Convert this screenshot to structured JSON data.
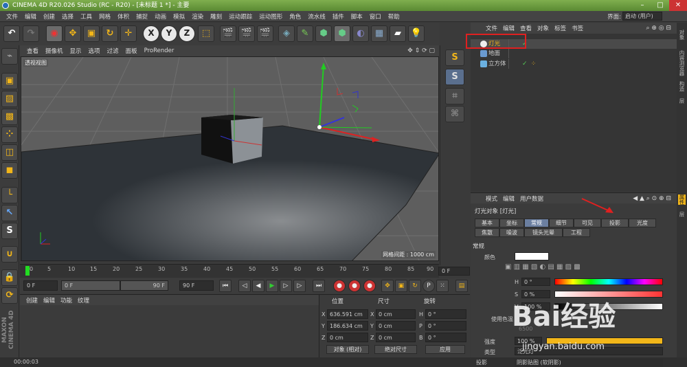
{
  "window": {
    "title": "CINEMA 4D R20.026 Studio (RC - R20) - [未标题 1 *] - 主要"
  },
  "menu": [
    "文件",
    "编辑",
    "创建",
    "选择",
    "工具",
    "网格",
    "体积",
    "捕捉",
    "动画",
    "模拟",
    "渲染",
    "雕刻",
    "运动跟踪",
    "运动图形",
    "角色",
    "流水线",
    "插件",
    "脚本",
    "窗口",
    "帮助"
  ],
  "layout": {
    "label": "界面:",
    "value": "启动 (用户)"
  },
  "toolbar": {
    "x_label": "X",
    "y_label": "Y",
    "z_label": "Z"
  },
  "viewport": {
    "menu": [
      "查看",
      "摄像机",
      "显示",
      "选项",
      "过滤",
      "面板",
      "ProRender"
    ],
    "label": "透视视图",
    "grid_label": "网格间距 : 1000 cm"
  },
  "timeline": {
    "ticks": [
      "0",
      "5",
      "10",
      "15",
      "20",
      "25",
      "30",
      "35",
      "40",
      "45",
      "50",
      "55",
      "60",
      "65",
      "70",
      "75",
      "80",
      "85",
      "90"
    ],
    "frame_value": "0 F",
    "start": "0 F",
    "min": "0 F",
    "max": "90 F",
    "end": "90 F"
  },
  "material_panel": {
    "tabs": [
      "创建",
      "编辑",
      "功能",
      "纹理"
    ]
  },
  "coords": {
    "headers": [
      "位置",
      "尺寸",
      "旋转"
    ],
    "pos": {
      "x": "636.591 cm",
      "y": "186.634 cm",
      "z": "0 cm"
    },
    "size": {
      "x": "0 cm",
      "y": "0 cm",
      "z": "0 cm"
    },
    "rot": {
      "h": "0 °",
      "p": "0 °",
      "b": "0 °"
    },
    "axis_labels": {
      "x": "X",
      "y": "Y",
      "z": "Z",
      "h": "H",
      "p": "P",
      "b": "B"
    },
    "mode": "对象 (相对)",
    "size_mode": "绝对尺寸",
    "apply": "应用"
  },
  "status": {
    "time": "00:00:03"
  },
  "brand": "MAXON CINEMA 4D",
  "object_manager": {
    "menu": [
      "文件",
      "编辑",
      "查看",
      "对象",
      "标签",
      "书签"
    ],
    "objects": [
      {
        "name": "灯光",
        "selected": true
      },
      {
        "name": "地面",
        "selected": false
      },
      {
        "name": "立方体",
        "selected": false
      }
    ]
  },
  "attribute_manager": {
    "menu": [
      "模式",
      "编辑",
      "用户数据"
    ],
    "title": "灯光对象 [灯光]",
    "tabs_row1": [
      "基本",
      "坐标",
      "常规",
      "细节",
      "可见",
      "投影",
      "光度"
    ],
    "tabs_row2": [
      "焦散",
      "噪波",
      "镜头光晕",
      "工程"
    ],
    "active_tab": "常规",
    "section": "常规",
    "color_label": "颜色",
    "h_label": "H",
    "h_value": "0 °",
    "s_label": "S",
    "s_value": "0 %",
    "v_label": "V",
    "v_value": "100 %",
    "use_temp": "使用色温",
    "temp_value": "6500",
    "intensity_label": "强度",
    "intensity_value": "100 %",
    "type_label": "类型",
    "type_value": "泛光灯",
    "shadow_label": "投影",
    "shadow_value": "阴影贴图 (软阴影)"
  },
  "right_tabs": [
    "对象",
    "内容浏览器",
    "构造",
    "层"
  ],
  "right_tabs2": [
    "属性",
    "层"
  ],
  "watermark": {
    "main": "Bai经验",
    "sub": "jingyan.baidu.com"
  }
}
